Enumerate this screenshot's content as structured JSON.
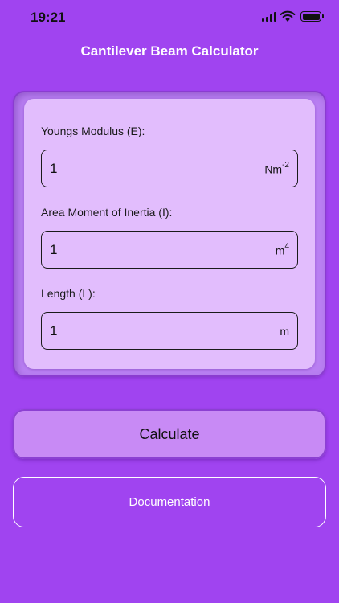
{
  "status_bar": {
    "time": "19:21",
    "signal_icon": "cellular-signal-icon",
    "wifi_icon": "wifi-icon",
    "battery_icon": "battery-icon",
    "battery_level": 1.0
  },
  "header": {
    "title": "Cantilever Beam Calculator"
  },
  "form": {
    "youngs_modulus": {
      "label": "Youngs Modulus (E):",
      "value": "1",
      "unit": "Nm",
      "unit_exp": "-2"
    },
    "area_moment": {
      "label": "Area Moment of Inertia (I):",
      "value": "1",
      "unit": "m",
      "unit_exp": "4"
    },
    "length": {
      "label": "Length (L):",
      "value": "1",
      "unit": "m"
    }
  },
  "actions": {
    "calculate_label": "Calculate",
    "documentation_label": "Documentation"
  },
  "colors": {
    "background": "#a044f0",
    "card_outer": "#b97ff2",
    "card_inner": "#e2bdfd",
    "calculate_button": "#c88af5"
  }
}
